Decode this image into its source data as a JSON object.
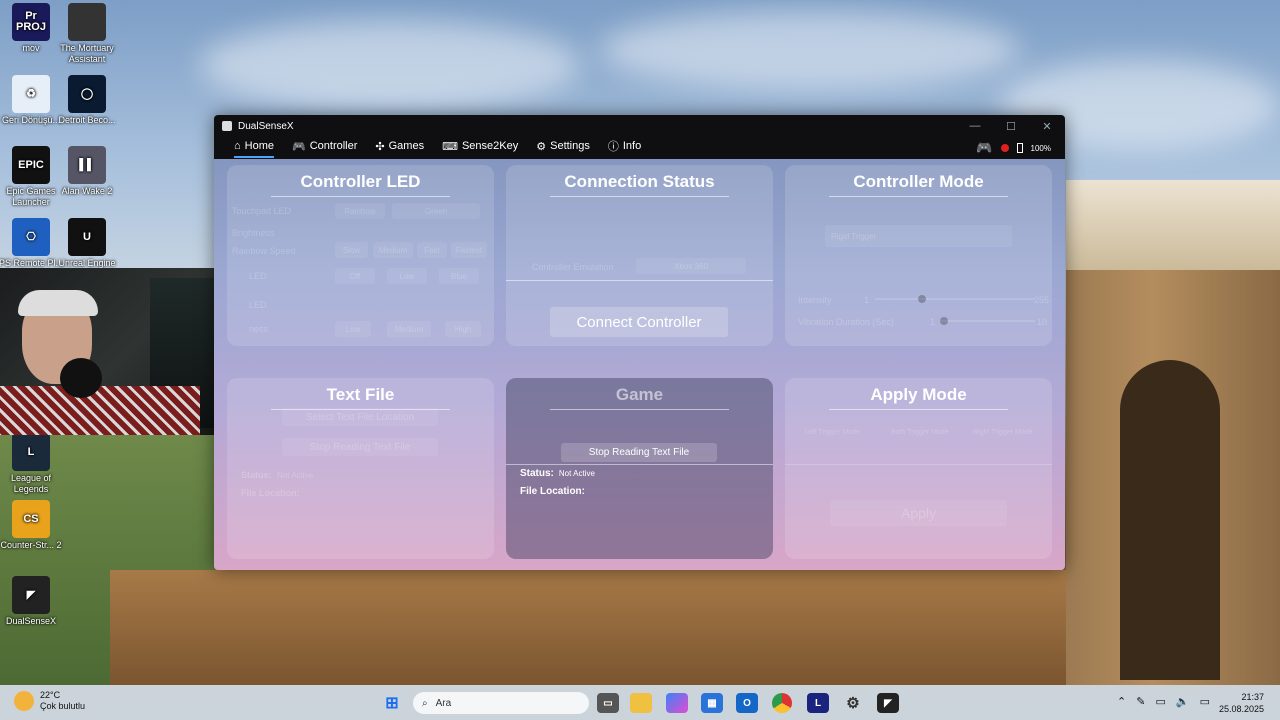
{
  "desktop_icons": [
    {
      "label": "mov",
      "glyph": "Pr\nPROJ",
      "color": "#1a1a5a",
      "name": "premiere-project-icon"
    },
    {
      "label": "The Mortuary Assistant",
      "glyph": "",
      "color": "#333",
      "name": "mortuary-assistant-icon"
    },
    {
      "label": "Geri Dönüşü...",
      "glyph": "♻",
      "color": "#e6eef8",
      "name": "recycle-bin-icon"
    },
    {
      "label": "Detroit Beco...",
      "glyph": "◯",
      "color": "#0a1a30",
      "name": "detroit-icon"
    },
    {
      "label": "Epic Games Launcher",
      "glyph": "EPIC",
      "color": "#111",
      "name": "epic-games-icon"
    },
    {
      "label": "Alan Wake 2",
      "glyph": "▌▌",
      "color": "#556",
      "name": "alan-wake-icon"
    },
    {
      "label": "PS Remote Pl...",
      "glyph": "⎔",
      "color": "#1f5fbf",
      "name": "ps-remote-play-icon"
    },
    {
      "label": "Unreal Engine",
      "glyph": "U",
      "color": "#111",
      "name": "unreal-engine-icon"
    },
    {
      "label": "League of Legends",
      "glyph": "L",
      "color": "#1b2a3a",
      "name": "league-of-legends-icon"
    },
    {
      "label": "Counter-Str... 2",
      "glyph": "CS",
      "color": "#e8a21c",
      "name": "counter-strike-icon"
    },
    {
      "label": "DualSenseX",
      "glyph": "◤",
      "color": "#222",
      "name": "dualsensex-desktop-icon"
    }
  ],
  "window": {
    "title": "DualSenseX",
    "controls": [
      "—",
      "☐",
      "✕"
    ],
    "tabs": [
      {
        "label": "Home",
        "icon": "⌂",
        "name": "home-icon"
      },
      {
        "label": "Controller",
        "icon": "🎮",
        "name": "controller-icon"
      },
      {
        "label": "Games",
        "icon": "✣",
        "name": "games-icon"
      },
      {
        "label": "Sense2Key",
        "icon": "⌨",
        "name": "keyboard-icon"
      },
      {
        "label": "Settings",
        "icon": "⚙",
        "name": "settings-icon"
      },
      {
        "label": "Info",
        "icon": "ⓘ",
        "name": "info-icon"
      }
    ],
    "battery": "100%"
  },
  "panels": {
    "controller_led": {
      "title": "Controller LED",
      "labels": [
        "Touchpad LED",
        "Brightness",
        "Rainbow Speed",
        "LED",
        "LED",
        "ness"
      ],
      "boxes": [
        "Rainbow",
        "Green",
        "Slow",
        "Medium",
        "Fast",
        "Fastest",
        "Off",
        "Low",
        "Blue",
        "Low",
        "Medium",
        "High"
      ]
    },
    "connection_status": {
      "title": "Connection Status",
      "emulation_label": "Controller Emulation",
      "emulation_value": "Xbox 360",
      "connect_button": "Connect Controller"
    },
    "controller_mode": {
      "title": "Controller Mode",
      "mode_value": "Rigid Trigger",
      "intensity_label": "Intensity",
      "intensity_min": "1",
      "intensity_max": "255",
      "vibration_label": "Vibration Duration (Sec)",
      "vibration_min": "1",
      "vibration_max": "10"
    },
    "text_file": {
      "title": "Text File",
      "select_button": "Select Text File Location",
      "stop_button": "Stop Reading Text File",
      "status_label": "Status:",
      "status_value": "Not Active",
      "file_label": "File Location:"
    },
    "game": {
      "title": "Game",
      "stop_button": "Stop Reading Text File",
      "status_label": "Status:",
      "status_value": "Not Active",
      "file_label": "File Location:"
    },
    "apply_mode": {
      "title": "Apply Mode",
      "options": [
        "Left Trigger Mode",
        "Both Trigger Mode",
        "Right Trigger Mode"
      ],
      "apply_button": "Apply"
    }
  },
  "taskbar": {
    "weather_temp": "22°C",
    "weather_desc": "Çok bulutlu",
    "weather_badge": "",
    "search_placeholder": "Ara",
    "time": "21:37",
    "date": "25.08.2025"
  }
}
